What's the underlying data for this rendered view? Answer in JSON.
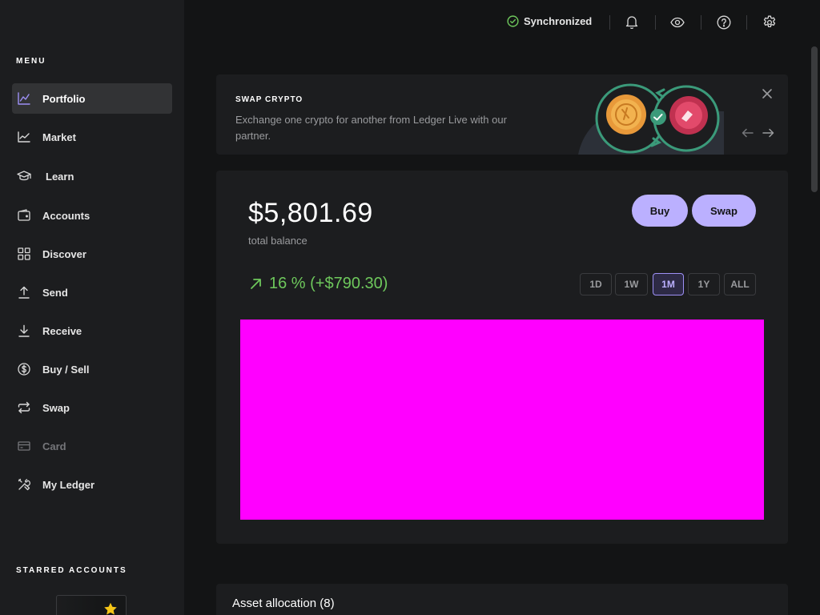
{
  "topbar": {
    "sync_label": "Synchronized"
  },
  "sidebar": {
    "menu_title": "MENU",
    "items": [
      {
        "label": "Portfolio",
        "icon": "chart-line-icon",
        "active": true
      },
      {
        "label": "Market",
        "icon": "market-icon"
      },
      {
        "label": "Learn",
        "icon": "graduation-cap-icon"
      },
      {
        "label": "Accounts",
        "icon": "wallet-icon"
      },
      {
        "label": "Discover",
        "icon": "grid-icon"
      },
      {
        "label": "Send",
        "icon": "upload-arrow-icon"
      },
      {
        "label": "Receive",
        "icon": "download-arrow-icon"
      },
      {
        "label": "Buy / Sell",
        "icon": "dollar-circle-icon"
      },
      {
        "label": "Swap",
        "icon": "swap-arrows-icon"
      },
      {
        "label": "Card",
        "icon": "card-icon",
        "disabled": true
      },
      {
        "label": "My Ledger",
        "icon": "tools-icon"
      }
    ],
    "starred_title": "STARRED ACCOUNTS"
  },
  "banner": {
    "title": "SWAP CRYPTO",
    "description": "Exchange one crypto for another from Ledger Live with our partner."
  },
  "portfolio": {
    "balance": "$5,801.69",
    "balance_label": "total balance",
    "buy_label": "Buy",
    "swap_label": "Swap",
    "change": "16 % (+$790.30)",
    "ranges": [
      "1D",
      "1W",
      "1M",
      "1Y",
      "ALL"
    ],
    "selected_range": "1M"
  },
  "assets": {
    "title": "Asset allocation (8)"
  },
  "colors": {
    "accent": "#bbb0ff",
    "positive": "#6ec85c",
    "background": "#131415",
    "panel": "#1c1d1f",
    "chart_placeholder": "#ff00ff"
  }
}
